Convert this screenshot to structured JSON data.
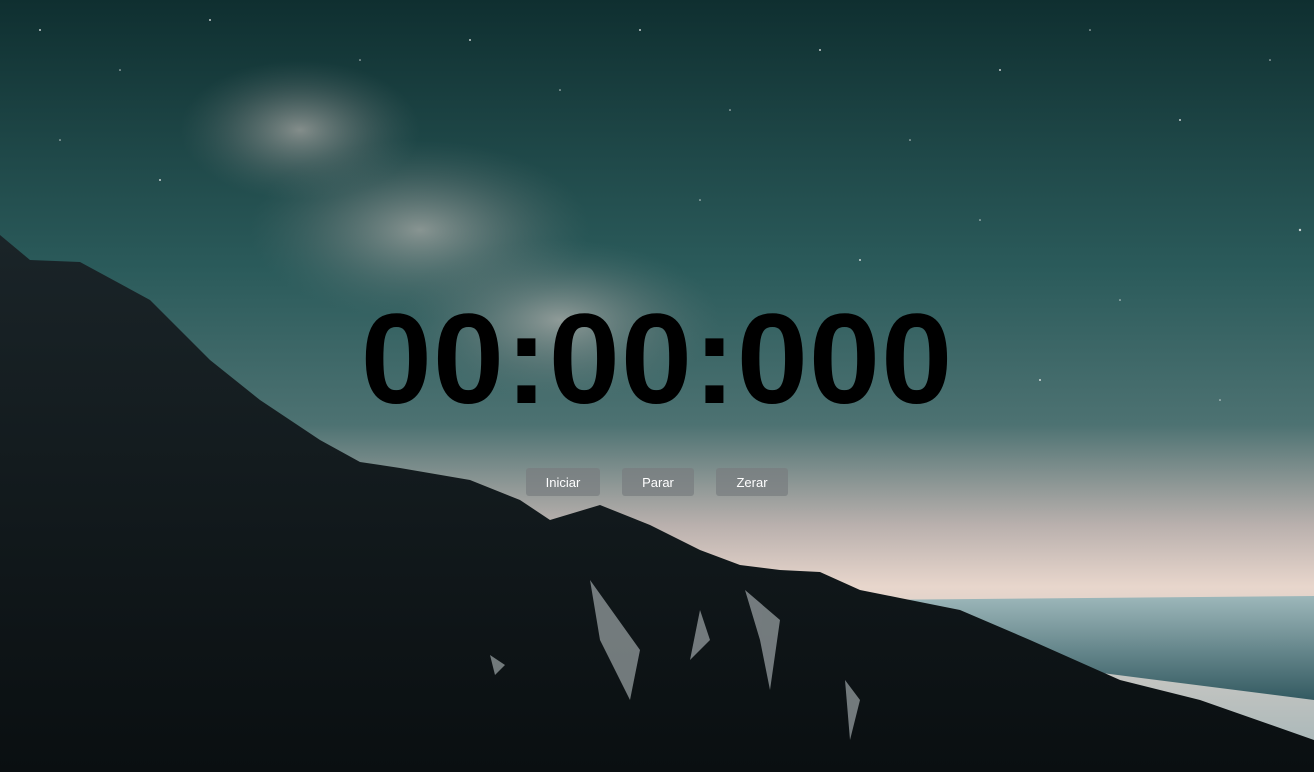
{
  "timer": {
    "display": "00:00:000"
  },
  "controls": {
    "start_label": "Iniciar",
    "stop_label": "Parar",
    "reset_label": "Zerar"
  },
  "background": {
    "description_colors": {
      "sky_top": "#123535",
      "sky_mid": "#2e5f60",
      "horizon_glow": "#e8d2c8",
      "mountain": "#0d1518",
      "sea": "#4f7a80"
    }
  }
}
